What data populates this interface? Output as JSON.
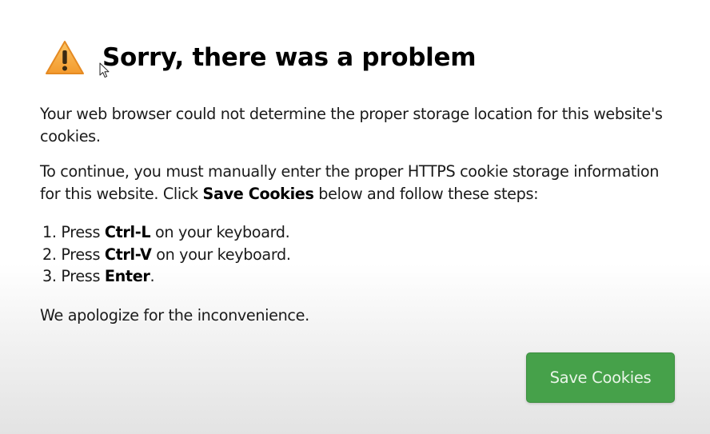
{
  "dialog": {
    "icon": "warning-triangle-icon",
    "title": "Sorry, there was a problem",
    "paragraph1": "Your web browser could not determine the proper storage location for this website's cookies.",
    "paragraph2_prefix": "To continue, you must manually enter the proper HTTPS cookie storage information for this website. Click ",
    "paragraph2_bold": "Save Cookies",
    "paragraph2_suffix": " below and follow these steps:",
    "steps": [
      {
        "prefix": "1. Press ",
        "key": "Ctrl-L",
        "suffix": " on your keyboard."
      },
      {
        "prefix": "2. Press ",
        "key": "Ctrl-V",
        "suffix": " on your keyboard."
      },
      {
        "prefix": "3. Press ",
        "key": "Enter",
        "suffix": "."
      }
    ],
    "closing": "We apologize for the inconvenience.",
    "button_label": "Save Cookies"
  },
  "colors": {
    "button_bg": "#46a14a",
    "button_text": "#e9f5e8",
    "warning_fill": "#f7b14a",
    "title_text": "#000000"
  },
  "cursor": "mouse-pointer-icon"
}
